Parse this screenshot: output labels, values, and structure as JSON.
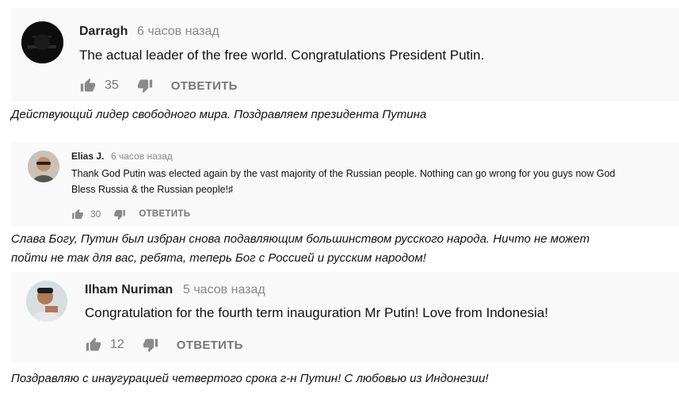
{
  "comments": [
    {
      "author": "Darragh",
      "time": "6 часов назад",
      "text": "The actual leader of the free world. Congratulations President Putin.",
      "likes": "35",
      "reply_label": "ОТВЕТИТЬ",
      "translation": "Действующий лидер свободного мира. Поздравляем президента Путина"
    },
    {
      "author": "Elias J.",
      "time": "6 часов назад",
      "text_line1": "Thank God Putin was elected again by the vast majority of the Russian people. Nothing can go wrong for you guys now God",
      "text_line2": "Bless Russia & the Russian people!♯",
      "likes": "30",
      "reply_label": "ОТВЕТИТЬ",
      "translation_line1": "Слава Богу, Путин был избран снова подавляющим большинством русского народа. Ничто не может",
      "translation_line2": "пойти не так для вас, ребята, теперь Бог с Россией и русским народом!"
    },
    {
      "author": "Ilham Nuriman",
      "time": "5 часов назад",
      "text": "Congratulation for the fourth term inauguration Mr Putin! Love from Indonesia!",
      "likes": "12",
      "reply_label": "ОТВЕТИТЬ",
      "translation": "Поздравляю с инаугурацией четвертого срока г-н Путин! С любовью из Индонезии!"
    }
  ],
  "icons": {
    "like": "thumbs-up-icon",
    "dislike": "thumbs-down-icon"
  },
  "colors": {
    "panel_bg": "#f9f9f9",
    "meta_gray": "#888888",
    "action_gray": "#777777"
  }
}
